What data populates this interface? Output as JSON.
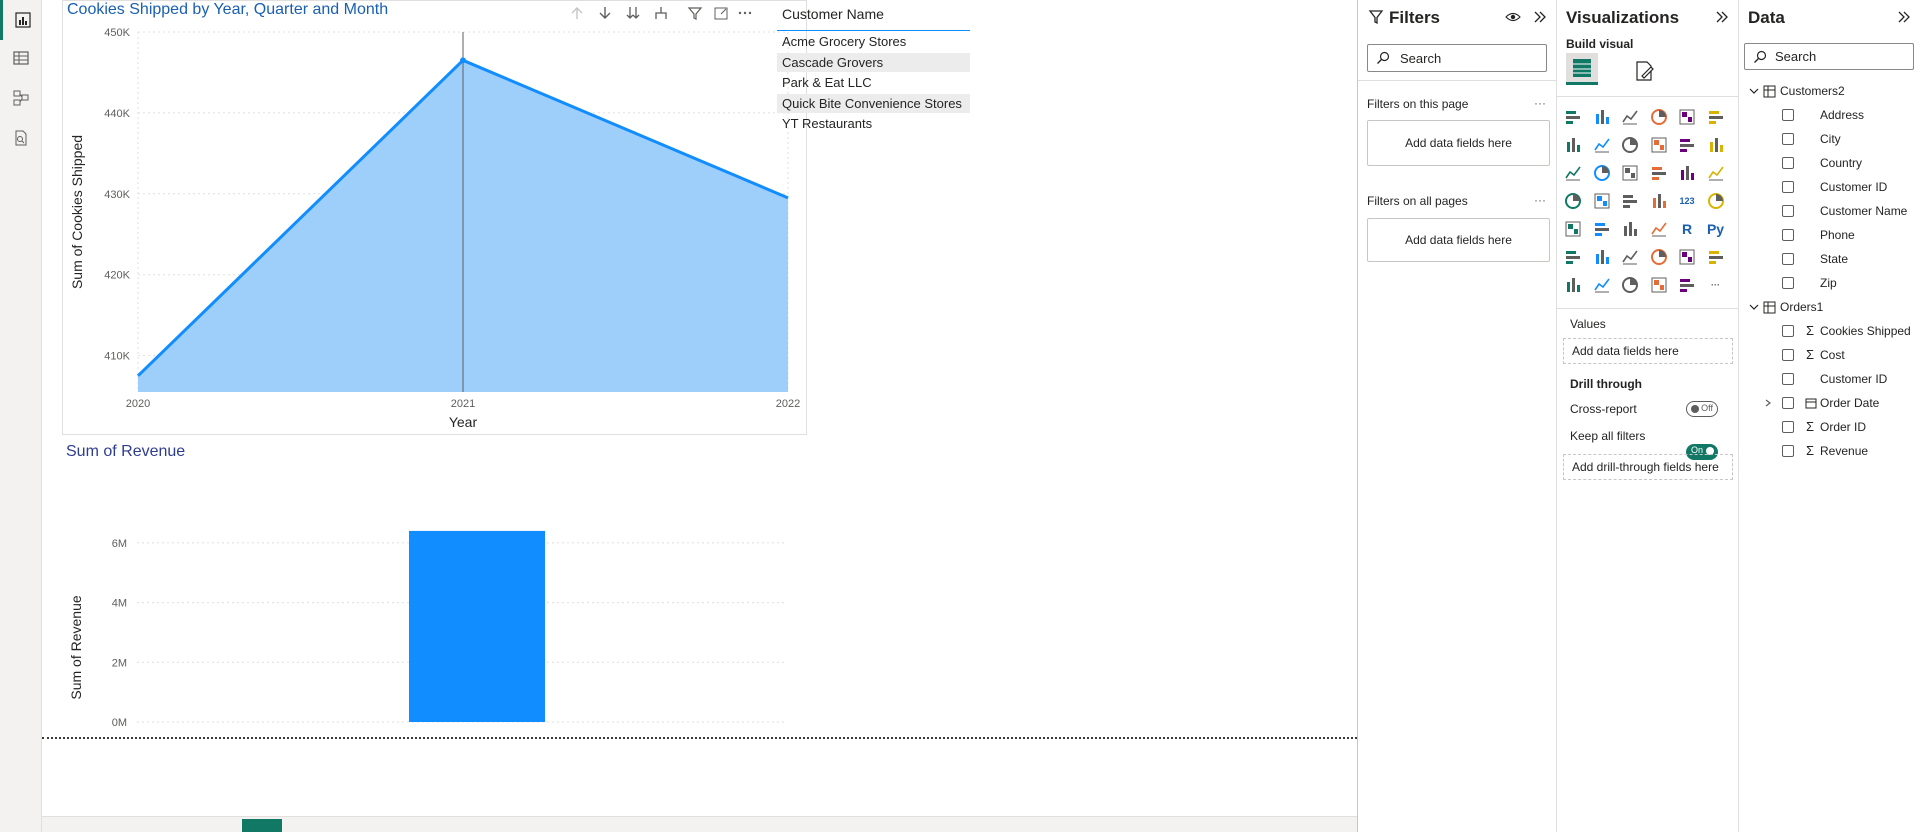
{
  "left_rail": {
    "items": [
      {
        "name": "report-view-icon",
        "active": true
      },
      {
        "name": "table-view-icon",
        "active": false
      },
      {
        "name": "model-view-icon",
        "active": false
      },
      {
        "name": "dax-query-view-icon",
        "active": false
      }
    ]
  },
  "line_visual": {
    "title": "Cookies Shipped by Year, Quarter and Month",
    "toolbar_icons": [
      "arrow-up-icon",
      "arrow-down-icon",
      "double-arrow-down-icon",
      "expand-hierarchy-icon",
      "filter-icon",
      "focus-mode-icon",
      "more-options-icon"
    ]
  },
  "bar_visual": {
    "title": "Sum of Revenue"
  },
  "chart_data": [
    {
      "type": "area",
      "title": "Cookies Shipped by Year, Quarter and Month",
      "xlabel": "Year",
      "ylabel": "Sum of Cookies Shipped",
      "x": [
        "2020",
        "2021",
        "2022"
      ],
      "series": [
        {
          "values": [
            407500,
            446500,
            429500
          ]
        }
      ],
      "y_ticks": [
        "410K",
        "420K",
        "430K",
        "440K",
        "450K"
      ],
      "ylim": [
        405500,
        450000
      ],
      "grid": true,
      "colors": {
        "line": "#118DFF",
        "fill": "#9ecffb",
        "crosshair": "#605e5c"
      }
    },
    {
      "type": "bar",
      "title": "Sum of Revenue",
      "ylabel": "Sum of Revenue",
      "categories": [
        ""
      ],
      "values": [
        6400000
      ],
      "y_ticks": [
        "0M",
        "2M",
        "4M",
        "6M"
      ],
      "ylim": [
        0,
        7000000
      ],
      "grid": true,
      "colors": {
        "bar": "#118DFF"
      }
    }
  ],
  "slicer": {
    "header": "Customer Name",
    "items": [
      {
        "label": "Acme Grocery Stores",
        "selected": false
      },
      {
        "label": "Cascade Grovers",
        "selected": true
      },
      {
        "label": "Park & Eat LLC",
        "selected": false
      },
      {
        "label": "Quick Bite Convenience Stores",
        "selected": true
      },
      {
        "label": "YT Restaurants",
        "selected": false
      }
    ]
  },
  "filters_pane": {
    "title": "Filters",
    "search_placeholder": "Search",
    "on_this_page": "Filters on this page",
    "on_all_pages": "Filters on all pages",
    "add_fields": "Add data fields here",
    "more": "···"
  },
  "viz_pane": {
    "title": "Visualizations",
    "build_visual": "Build visual",
    "values_label": "Values",
    "values_well": "Add data fields here",
    "drill_through": "Drill through",
    "cross_report": "Cross-report",
    "cross_report_state": "Off",
    "keep_all_filters": "Keep all filters",
    "keep_all_filters_state": "On",
    "drill_well": "Add drill-through fields here",
    "icons": [
      "stacked-bar-chart-icon",
      "stacked-column-chart-icon",
      "clustered-bar-chart-icon",
      "clustered-column-chart-icon",
      "100-stacked-bar-chart-icon",
      "100-stacked-column-chart-icon",
      "line-chart-icon",
      "area-chart-icon",
      "stacked-area-chart-icon",
      "line-and-stacked-column-chart-icon",
      "line-and-clustered-column-chart-icon",
      "ribbon-chart-icon",
      "waterfall-chart-icon",
      "funnel-chart-icon",
      "scatter-chart-icon",
      "pie-chart-icon",
      "donut-chart-icon",
      "treemap-icon",
      "map-icon",
      "filled-map-icon",
      "azure-map-icon",
      "gauge-icon",
      "card-icon",
      "multi-row-card-icon",
      "kpi-icon",
      "slicer-icon",
      "table-icon",
      "matrix-icon",
      "r-script-icon",
      "python-visual-icon",
      "key-influencers-icon",
      "decomposition-tree-icon",
      "qa-icon",
      "smart-narrative-icon",
      "metrics-icon",
      "paginated-report-icon",
      "power-apps-icon",
      "power-automate-icon",
      "arcgis-map-icon",
      "diamond-visual-icon",
      "chevron-visual-icon",
      "more-visuals-icon"
    ],
    "icon_text": {
      "r-script-icon": "R",
      "python-visual-icon": "Py",
      "card-icon": "123",
      "more-visuals-icon": "···"
    }
  },
  "data_pane": {
    "title": "Data",
    "search_placeholder": "Search",
    "tables": [
      {
        "name": "Customers2",
        "fields": [
          {
            "name": "Address",
            "sigma": false
          },
          {
            "name": "City",
            "sigma": false
          },
          {
            "name": "Country",
            "sigma": false
          },
          {
            "name": "Customer ID",
            "sigma": false
          },
          {
            "name": "Customer Name",
            "sigma": false
          },
          {
            "name": "Phone",
            "sigma": false
          },
          {
            "name": "State",
            "sigma": false
          },
          {
            "name": "Zip",
            "sigma": false
          }
        ]
      },
      {
        "name": "Orders1",
        "fields": [
          {
            "name": "Cookies Shipped",
            "sigma": true
          },
          {
            "name": "Cost",
            "sigma": true
          },
          {
            "name": "Customer ID",
            "sigma": false
          },
          {
            "name": "Order Date",
            "sigma": false,
            "calendar": true,
            "expandable": true
          },
          {
            "name": "Order ID",
            "sigma": true
          },
          {
            "name": "Revenue",
            "sigma": true
          }
        ]
      }
    ]
  },
  "sigma_symbol": "Σ"
}
